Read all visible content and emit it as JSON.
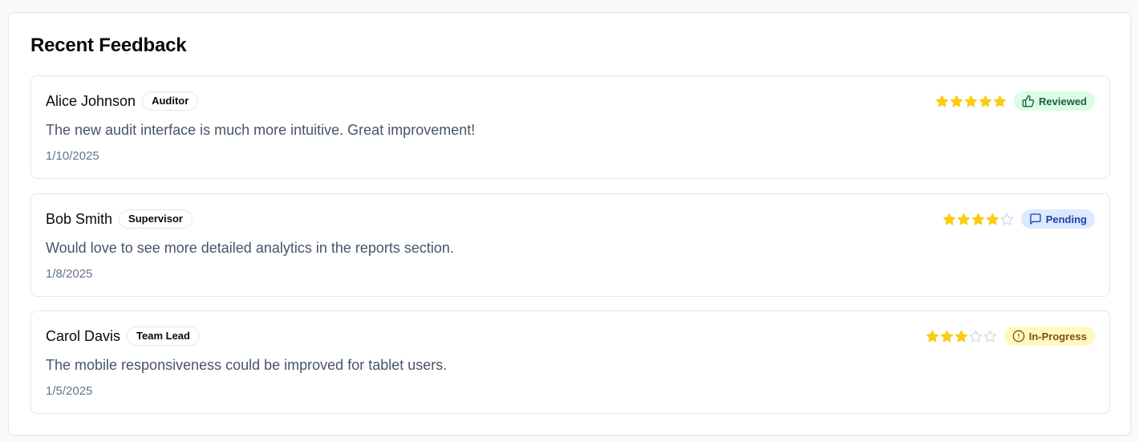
{
  "panel": {
    "title": "Recent Feedback"
  },
  "colors": {
    "star_filled": "#facc15",
    "star_empty": "#cbd5e1",
    "reviewed_bg": "#dcfce7",
    "pending_bg": "#dbeafe",
    "in_progress_bg": "#fef9c3"
  },
  "feedback": [
    {
      "name": "Alice Johnson",
      "role": "Auditor",
      "comment": "The new audit interface is much more intuitive. Great improvement!",
      "date": "1/10/2025",
      "rating": 5,
      "status": "Reviewed",
      "status_icon": "thumbs-up-icon"
    },
    {
      "name": "Bob Smith",
      "role": "Supervisor",
      "comment": "Would love to see more detailed analytics in the reports section.",
      "date": "1/8/2025",
      "rating": 4,
      "status": "Pending",
      "status_icon": "message-square-icon"
    },
    {
      "name": "Carol Davis",
      "role": "Team Lead",
      "comment": "The mobile responsiveness could be improved for tablet users.",
      "date": "1/5/2025",
      "rating": 3,
      "status": "In-Progress",
      "status_icon": "alert-circle-icon"
    }
  ]
}
